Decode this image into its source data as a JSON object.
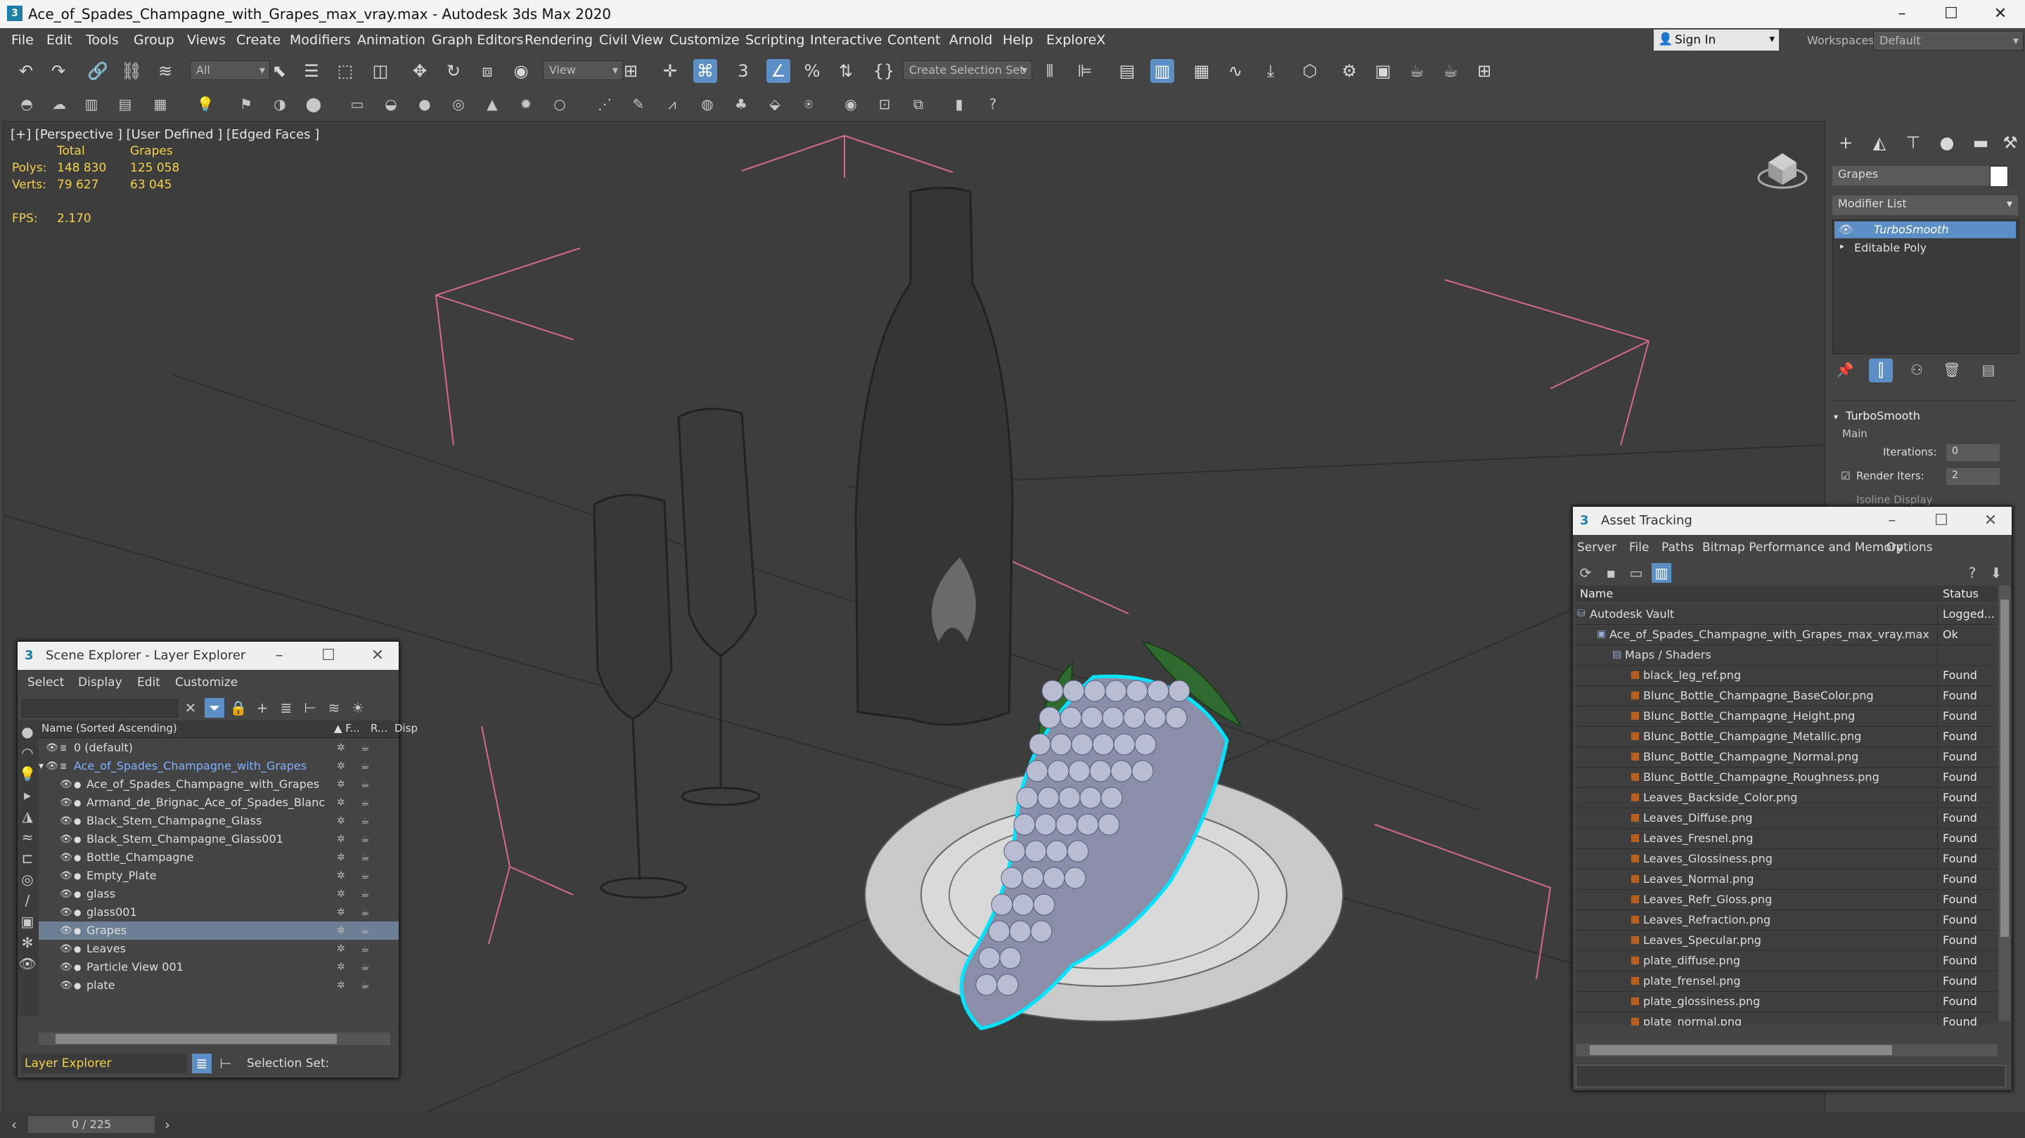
{
  "window": {
    "title": "Ace_of_Spades_Champagne_with_Grapes_max_vray.max - Autodesk 3ds Max 2020",
    "app_icon": "3"
  },
  "menu": [
    "File",
    "Edit",
    "Tools",
    "Group",
    "Views",
    "Create",
    "Modifiers",
    "Animation",
    "Graph Editors",
    "Rendering",
    "Civil View",
    "Customize",
    "Scripting",
    "Interactive",
    "Content",
    "Arnold",
    "Help",
    "ExploreX"
  ],
  "signin": {
    "label": "Sign In",
    "workspaces_label": "Workspaces:",
    "workspace_value": "Default"
  },
  "toolbar": {
    "filter_value": "All",
    "view_value": "View",
    "selection_set": "Create Selection Set"
  },
  "viewport": {
    "label": "[+] [Perspective ] [User Defined ] [Edged Faces ]",
    "stats_header_total": "Total",
    "stats_header_obj": "Grapes",
    "polys_label": "Polys:",
    "polys_total": "148 830",
    "polys_obj": "125 058",
    "verts_label": "Verts:",
    "verts_total": "79 627",
    "verts_obj": "63 045",
    "fps_label": "FPS:",
    "fps_value": "2.170"
  },
  "command_panel": {
    "object_name": "Grapes",
    "modifier_list": "Modifier List",
    "stack": [
      "TurboSmooth",
      "Editable Poly"
    ],
    "rollout_title": "TurboSmooth",
    "main_label": "Main",
    "iterations_label": "Iterations:",
    "iterations_value": "0",
    "render_iters_label": "Render Iters:",
    "render_iters_value": "2",
    "isoline_label": "Isoline Display"
  },
  "scene_explorer": {
    "title": "Scene Explorer - Layer Explorer",
    "menu": [
      "Select",
      "Display",
      "Edit",
      "Customize"
    ],
    "col_name": "Name (Sorted Ascending)",
    "col_f": "▲ F...",
    "col_r": "R...",
    "col_disp": "Disp",
    "rows": [
      {
        "label": "0 (default)",
        "indent": 0
      },
      {
        "label": "Ace_of_Spades_Champagne_with_Grapes",
        "indent": 0
      },
      {
        "label": "Ace_of_Spades_Champagne_with_Grapes",
        "indent": 1
      },
      {
        "label": "Armand_de_Brignac_Ace_of_Spades_Blanc",
        "indent": 1
      },
      {
        "label": "Black_Stem_Champagne_Glass",
        "indent": 1
      },
      {
        "label": "Black_Stem_Champagne_Glass001",
        "indent": 1
      },
      {
        "label": "Bottle_Champagne",
        "indent": 1
      },
      {
        "label": "Empty_Plate",
        "indent": 1
      },
      {
        "label": "glass",
        "indent": 1
      },
      {
        "label": "glass001",
        "indent": 1
      },
      {
        "label": "Grapes",
        "indent": 1
      },
      {
        "label": "Leaves",
        "indent": 1
      },
      {
        "label": "Particle View 001",
        "indent": 1
      },
      {
        "label": "plate",
        "indent": 1
      }
    ],
    "footer_mode": "Layer Explorer",
    "selection_set_label": "Selection Set:"
  },
  "asset_tracking": {
    "title": "Asset Tracking",
    "menu": [
      "Server",
      "File",
      "Paths",
      "Bitmap Performance and Memory",
      "Options"
    ],
    "col_name": "Name",
    "col_status": "Status",
    "rows": [
      {
        "name": "Autodesk Vault",
        "status": "Logged...",
        "level": 0
      },
      {
        "name": "Ace_of_Spades_Champagne_with_Grapes_max_vray.max",
        "status": "Ok",
        "level": 1
      },
      {
        "name": "Maps / Shaders",
        "status": "",
        "level": 2
      },
      {
        "name": "black_leg_ref.png",
        "status": "Found",
        "level": 3
      },
      {
        "name": "Blunc_Bottle_Champagne_BaseColor.png",
        "status": "Found",
        "level": 3
      },
      {
        "name": "Blunc_Bottle_Champagne_Height.png",
        "status": "Found",
        "level": 3
      },
      {
        "name": "Blunc_Bottle_Champagne_Metallic.png",
        "status": "Found",
        "level": 3
      },
      {
        "name": "Blunc_Bottle_Champagne_Normal.png",
        "status": "Found",
        "level": 3
      },
      {
        "name": "Blunc_Bottle_Champagne_Roughness.png",
        "status": "Found",
        "level": 3
      },
      {
        "name": "Leaves_Backside_Color.png",
        "status": "Found",
        "level": 3
      },
      {
        "name": "Leaves_Diffuse.png",
        "status": "Found",
        "level": 3
      },
      {
        "name": "Leaves_Fresnel.png",
        "status": "Found",
        "level": 3
      },
      {
        "name": "Leaves_Glossiness.png",
        "status": "Found",
        "level": 3
      },
      {
        "name": "Leaves_Normal.png",
        "status": "Found",
        "level": 3
      },
      {
        "name": "Leaves_Refr_Gloss.png",
        "status": "Found",
        "level": 3
      },
      {
        "name": "Leaves_Refraction.png",
        "status": "Found",
        "level": 3
      },
      {
        "name": "Leaves_Specular.png",
        "status": "Found",
        "level": 3
      },
      {
        "name": "plate_diffuse.png",
        "status": "Found",
        "level": 3
      },
      {
        "name": "plate_frensel.png",
        "status": "Found",
        "level": 3
      },
      {
        "name": "plate_glossiness.png",
        "status": "Found",
        "level": 3
      },
      {
        "name": "plate_normal.png",
        "status": "Found",
        "level": 3
      }
    ]
  },
  "timeline": {
    "frame": "0 / 225"
  },
  "colors": {
    "accent": "#5b8fc6",
    "selection": "#00e5ff",
    "stats": "#f3d247",
    "gizmo": "#d46a8a"
  }
}
